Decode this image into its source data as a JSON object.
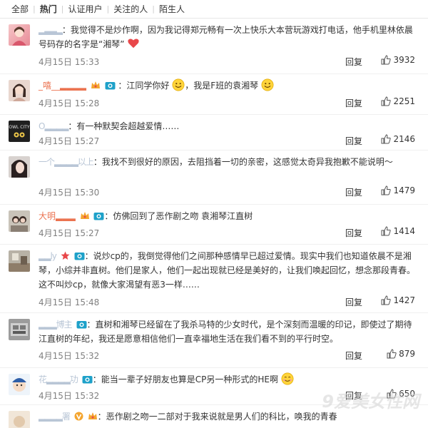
{
  "tabs": [
    "全部",
    "热门",
    "认证用户",
    "关注的人",
    "陌生人"
  ],
  "reply_label": "回复",
  "colors": {
    "username": "#eb7350",
    "meta": "#808080",
    "icon_blue": "#1ea1c9",
    "heart": "#e8474a"
  },
  "comments": [
    {
      "user": "▂▃▃▂",
      "text_a": "：我觉得不是炒作啊，因为我记得郑元畅有一次上快乐大本营玩游戏打电话，他手机里林依晨号码存的名字是“湘琴”",
      "text_b": "",
      "emoji": "heart-emoji",
      "time": "4月15日 15:33",
      "likes": "3932",
      "avatar": "avatar-girl-pink"
    },
    {
      "user": "_嘻__▂▂▂▂",
      "text_a": "：江同学你好",
      "text_b": "，我是F班的袁湘琴",
      "emoji": "smile-emoji",
      "time": "4月15日 15:28",
      "likes": "2251",
      "avatar": "avatar-girl-portrait"
    },
    {
      "user": "O▂▂▂▂",
      "text_a": "：有一种默契会超越爱情……",
      "text_b": "",
      "emoji": "",
      "time": "4月15日 15:27",
      "likes": "2146",
      "avatar": "avatar-owl-city"
    },
    {
      "user": "一个▂▂▂▂以上",
      "text_a": "：我找不到很好的原因，去阻挡着一切的亲密，这感觉太奇异我抱歉不能说明～",
      "text_b": "",
      "emoji": "",
      "time": "4月15日 15:30",
      "likes": "1479",
      "avatar": "avatar-dark-hair"
    },
    {
      "user": "大明▂▂▂",
      "text_a": "：仿佛回到了恶作剧之吻 袁湘琴江直树",
      "text_b": "",
      "emoji": "",
      "time": "4月15日 15:27",
      "likes": "1414",
      "avatar": "avatar-couple"
    },
    {
      "user": "▂▂ly",
      "text_a": "：说炒cp的，我倒觉得他们之间那种感情早已超过爱情。现实中我们也知道依晨不是湘琴，小综并非直树。他们是家人，他们一起出现就已经是美好的，让我们唤起回忆，想念那段青春。这不叫炒cp，就像大家渴望有恶3一样……",
      "text_b": "",
      "emoji": "",
      "time": "4月15日 15:48",
      "likes": "1427",
      "avatar": "avatar-room"
    },
    {
      "user": "▂▂▂博主",
      "text_a": "：直树和湘琴已经留在了我杀马特的少女时代，是个深刻而温暖的印记，即使过了期待江直树的年纪，我还是愿意相信他们一直幸福地生活在我们看不到的平行时空。",
      "text_b": "",
      "emoji": "",
      "time": "4月15日 15:32",
      "likes": "879",
      "avatar": "avatar-gray"
    },
    {
      "user": "花▂▂▂▂功",
      "text_a": "：能当一辈子好朋友也算是CP另一种形式的HE啊",
      "text_b": "",
      "emoji": "cheeky-emoji",
      "time": "4月15日 15:32",
      "likes": "650",
      "avatar": "avatar-cartoon"
    },
    {
      "user": "▂▂▂▂署",
      "text_a": "：恶作剧之吻一二部对于我来说就是男人们的科比，唤我的青春",
      "text_b": "",
      "emoji": "",
      "time": "",
      "likes": "",
      "avatar": "avatar-partial"
    }
  ],
  "watermark": "9爱美女性网"
}
